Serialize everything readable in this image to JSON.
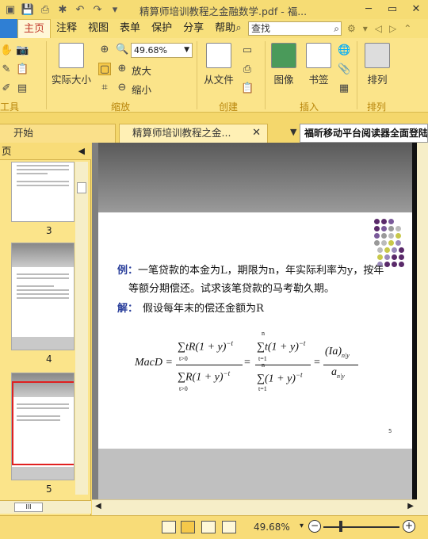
{
  "titlebar": {
    "title": "精算师培训教程之金融数学.pdf - 福..."
  },
  "menu": {
    "file_label": "",
    "items": [
      "主页",
      "注释",
      "视图",
      "表单",
      "保护",
      "分享",
      "帮助"
    ],
    "active": "主页",
    "search_placeholder": "查找"
  },
  "ribbon": {
    "actual_size": "实际大小",
    "zoom_value": "49.68%",
    "zoom_in": "放大",
    "zoom_out": "缩小",
    "from_file": "从文件",
    "image": "图像",
    "bookmark": "书签",
    "arrange": "排列",
    "groups": {
      "tools": "工具",
      "zoom": "缩放",
      "create": "创建",
      "insert": "插入",
      "arrange": "排列"
    }
  },
  "tabs": {
    "start": "开始",
    "doc": "精算师培训教程之金...",
    "banner": "福昕移动平台阅读器全面登陆"
  },
  "leftpanel": {
    "header": "页",
    "pages": [
      "3",
      "4",
      "5"
    ]
  },
  "document": {
    "example_label": "例：",
    "example_line1": "一笔贷款的本金为L，期限为n，年实际利率为y，按年",
    "example_line2": "等额分期偿还。试求该笔贷款的马考勒久期。",
    "solution_label": "解：",
    "solution_text": "假设每年末的偿还金额为R",
    "formula": {
      "lhs": "MacD =",
      "num1": "∑tR(1 + y)",
      "den1": "∑R(1 + y)",
      "num2": "∑t(1 + y)",
      "den2": "∑(1 + y)",
      "exp": "−t",
      "sub_t0": "t>0",
      "sub_t1": "t=1",
      "sup_n": "n",
      "eq": "=",
      "rhs_num": "(Ia)",
      "rhs_num_sub": "n|y",
      "rhs_den": "a",
      "rhs_den_sub": "n|y"
    },
    "page_number": "5"
  },
  "status": {
    "zoom": "49.68%"
  },
  "colors": {
    "ribbon": "#fbe48a",
    "accent_blue": "#2f7fd4",
    "selection_red": "#e02020"
  }
}
